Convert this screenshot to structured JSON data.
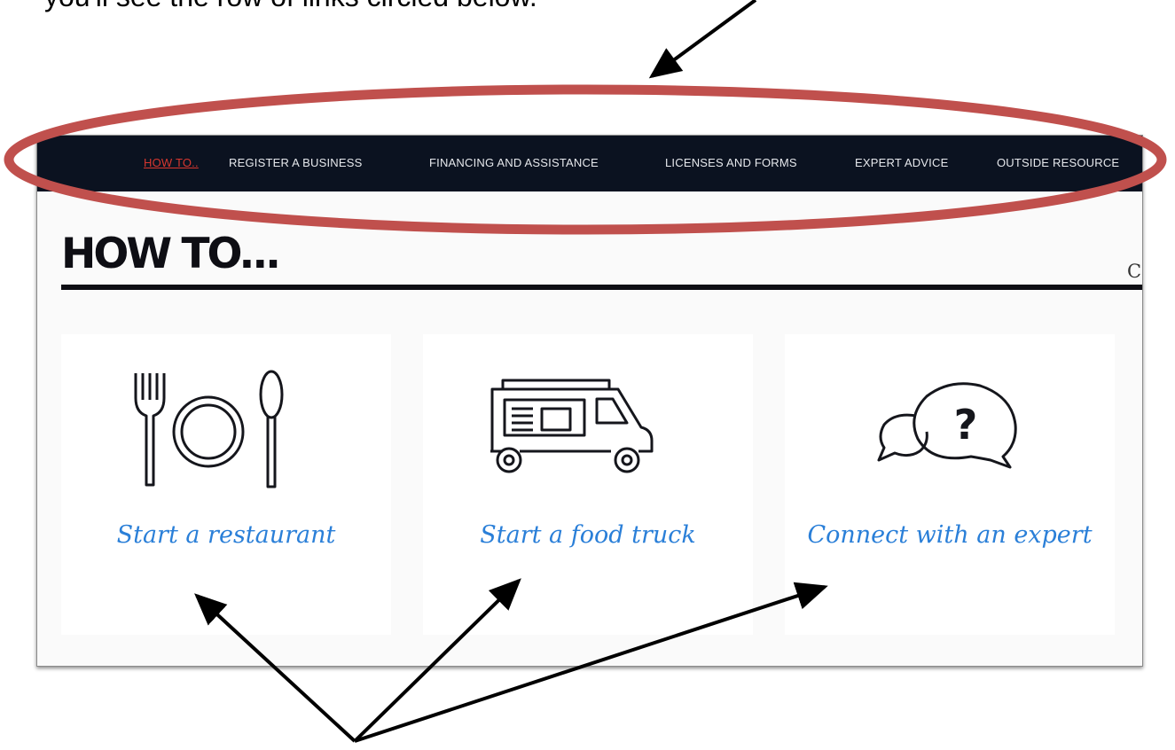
{
  "caption": "you'll see the row of links circled below.",
  "nav": {
    "items": [
      {
        "label": "HOW TO..",
        "active": true
      },
      {
        "label": "REGISTER A BUSINESS"
      },
      {
        "label": "FINANCING AND ASSISTANCE"
      },
      {
        "label": "LICENSES AND FORMS"
      },
      {
        "label": "EXPERT ADVICE"
      },
      {
        "label": "OUTSIDE RESOURCE"
      }
    ]
  },
  "page": {
    "heading": "HOW TO...",
    "cut_text": "Co"
  },
  "cards": [
    {
      "icon": "restaurant-icon",
      "title": "Start a restaurant"
    },
    {
      "icon": "food-truck-icon",
      "title": "Start a food truck"
    },
    {
      "icon": "expert-chat-icon",
      "title": "Connect with an expert"
    }
  ],
  "colors": {
    "nav_background": "#0b1220",
    "nav_active": "#d8372f",
    "link_blue": "#2a7fd8",
    "annotation_red": "#c0504d"
  }
}
